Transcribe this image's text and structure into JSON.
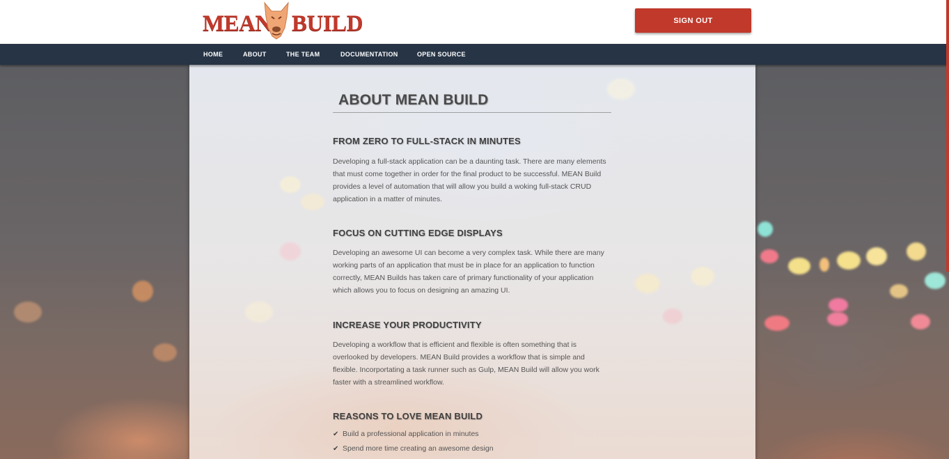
{
  "header": {
    "logo_left": "MEAN",
    "logo_right": "BUILD",
    "signout_label": "SIGN OUT"
  },
  "nav": {
    "items": [
      {
        "label": "HOME"
      },
      {
        "label": "ABOUT"
      },
      {
        "label": "THE TEAM"
      },
      {
        "label": "DOCUMENTATION"
      },
      {
        "label": "OPEN SOURCE"
      }
    ]
  },
  "main": {
    "title": "ABOUT MEAN BUILD",
    "sections": [
      {
        "heading": "FROM ZERO TO FULL-STACK IN MINUTES",
        "body": "Developing a full-stack application can be a daunting task. There are many elements that must come together in order for the final product to be successful. MEAN Build provides a level of automation that will allow you build a woking full-stack CRUD application in a matter of minutes."
      },
      {
        "heading": "FOCUS ON CUTTING EDGE DISPLAYS",
        "body": "Developing an awesome UI can become a very complex task. While there are many working parts of an application that must be in place for an application to function correctly, MEAN Builds has taken care of primary functionality of your application which allows you to focus on designing an amazing UI."
      },
      {
        "heading": "INCREASE YOUR PRODUCTIVITY",
        "body": "Developing a workflow that is efficient and flexible is often something that is overlooked by developers. MEAN Build provides a workflow that is simple and flexible. Incorportating a task runner such as Gulp, MEAN Build will allow you work faster with a streamlined workflow."
      },
      {
        "heading": "REASONS TO LOVE MEAN BUILD",
        "body": ""
      }
    ],
    "reasons": [
      "Build a professional application in minutes",
      "Spend more time creating an awesome design"
    ]
  },
  "colors": {
    "brand_red": "#c0392b",
    "nav_bg": "#263445"
  },
  "icons": {
    "reason_check": "check-icon",
    "logo_mascot": "dog-head-icon"
  }
}
